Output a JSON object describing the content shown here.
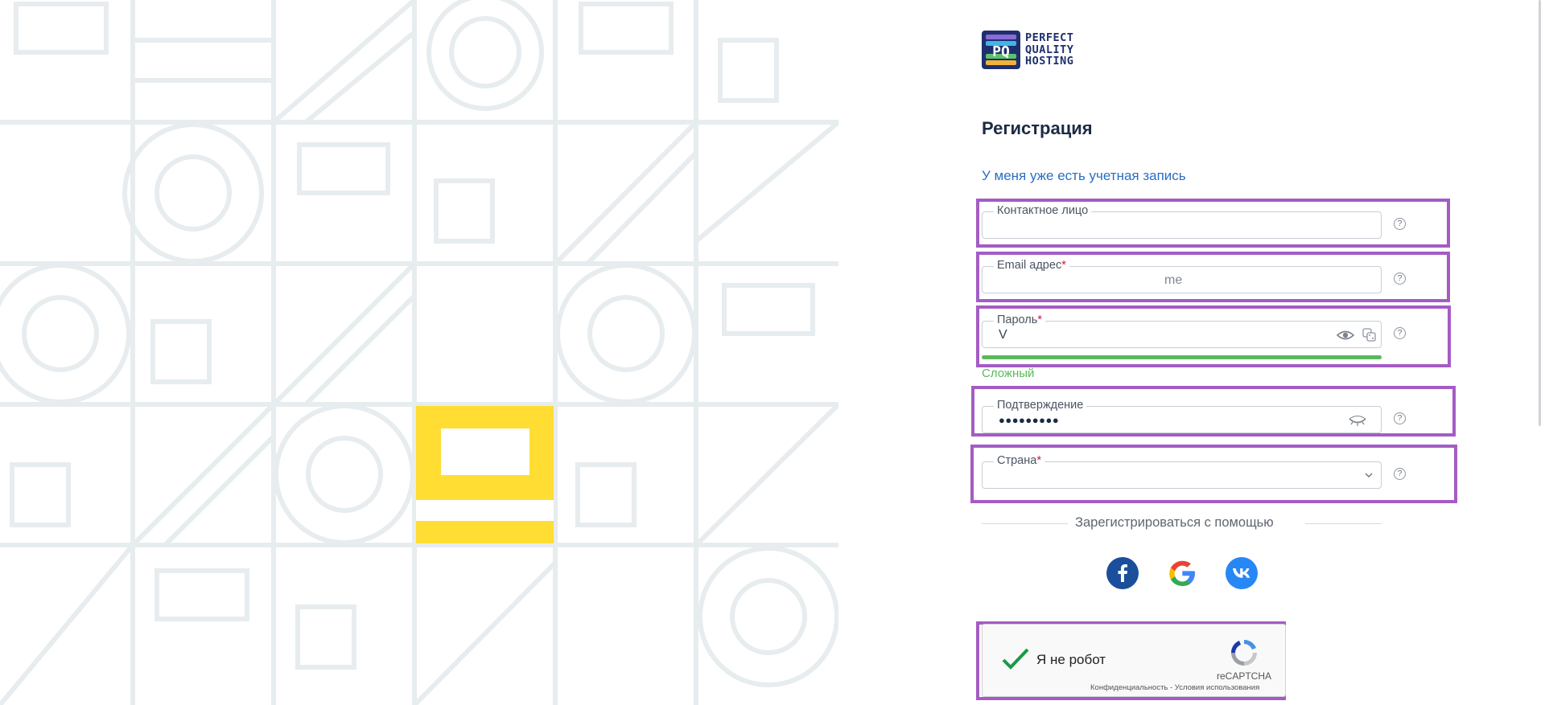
{
  "logo": {
    "line1": "PERFECT",
    "line2": "QUALITY",
    "line3": "HOSTING"
  },
  "form": {
    "title": "Регистрация",
    "login_link": "У меня уже есть учетная запись",
    "fields": {
      "contact": {
        "label": "Контактное лицо",
        "required": "",
        "value": ""
      },
      "email": {
        "label": "Email адрес",
        "required": "*",
        "value": "me"
      },
      "password": {
        "label": "Пароль",
        "required": "*",
        "value": "V"
      },
      "confirm": {
        "label": "Подтверждение",
        "required": "",
        "value": "●●●●●●●●●"
      },
      "country": {
        "label": "Страна",
        "required": "*",
        "value": ""
      }
    },
    "help_glyph": "?",
    "password_strength": {
      "label": "Сложный",
      "level": 1.0,
      "color": "#5cb85c"
    },
    "social_divider": "Зарегистрироваться с помощью",
    "social": [
      {
        "icon": "facebook-icon",
        "glyph": "f",
        "color": "#1b4f9c"
      },
      {
        "icon": "google-icon",
        "glyph": "G",
        "color": "#ffffff"
      },
      {
        "icon": "vk-icon",
        "glyph": "vk",
        "color": "#2787f5"
      }
    ]
  },
  "captcha": {
    "label": "Я не робот",
    "brand": "reCAPTCHA",
    "links": "Конфиденциальность - Условия использования",
    "checked": true
  },
  "colors": {
    "accent_link": "#2a6ec2",
    "highlight": "#a45cc4",
    "pattern_yellow": "#ffdd33",
    "pattern_line": "#e7ecef"
  }
}
